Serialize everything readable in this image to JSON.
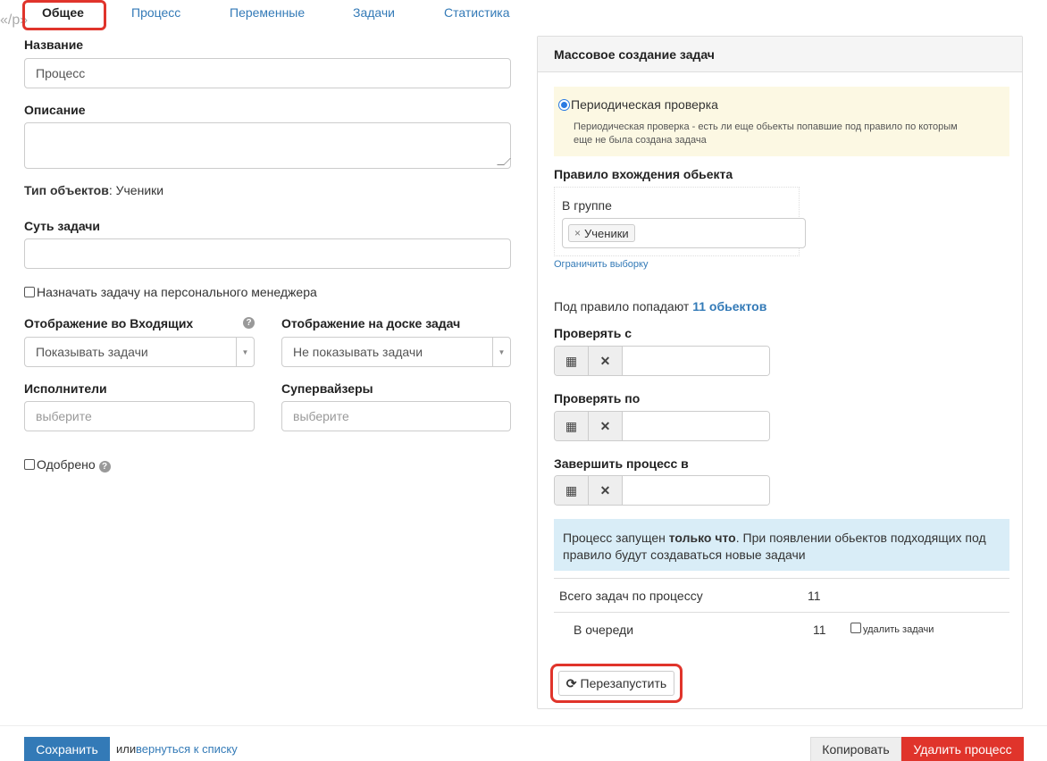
{
  "junk_text": "«/p»",
  "tabs": [
    {
      "label": "Общее"
    },
    {
      "label": "Процесс"
    },
    {
      "label": "Переменные"
    },
    {
      "label": "Задачи"
    },
    {
      "label": "Статистика"
    }
  ],
  "form": {
    "name_label": "Название",
    "name_value": "Процесс",
    "desc_label": "Описание",
    "desc_value": "",
    "object_type_label": "Тип объектов",
    "object_type_value": ": Ученики",
    "task_essence_label": "Суть задачи",
    "task_essence_value": "",
    "assign_manager_label": "Назначать задачу на персонального менеджера",
    "inbox_label": "Отображение во Входящих",
    "inbox_value": "Показывать задачи",
    "board_label": "Отображение на доске задач",
    "board_value": "Не показывать задачи",
    "executors_label": "Исполнители",
    "executors_placeholder": "выберите",
    "supervisors_label": "Супервайзеры",
    "supervisors_placeholder": "выберите",
    "approved_label": "Одобрено"
  },
  "panel": {
    "title": "Массовое создание задач",
    "radio_label": "Периодическая проверка",
    "radio_desc_1": "Периодическая проверка - есть ли еще обьекты попавшие под правило по которым",
    "radio_desc_2": "еще не была создана задача",
    "rule_label": "Правило вхождения обьекта",
    "in_group_label": "В группе",
    "tag_remove": "×",
    "tag_label": "Ученики",
    "limit_link": "Ограничить выборку",
    "matches_prefix": "Под правило попадают ",
    "matches_link": "11 обьектов",
    "check_from_label": "Проверять с",
    "check_to_label": "Проверять по",
    "finish_label": "Завершить процесс в",
    "info_prefix": "Процесс запущен ",
    "info_bold": "только что",
    "info_suffix_1": ". При появлении обьектов подходящих под",
    "info_suffix_2": "правило будут создаваться новые задачи",
    "total_label": "Всего задач по процессу",
    "total_value": "11",
    "queue_label": "В очереди",
    "queue_value": "11",
    "delete_tasks_label": "удалить задачи",
    "restart_label": "Перезапустить"
  },
  "footer": {
    "save_label": "Сохранить",
    "or_text": "или",
    "back_link": "вернуться к списку",
    "copy_label": "Копировать",
    "delete_label": "Удалить процесс"
  },
  "colors": {
    "accent": "#337ab7",
    "danger": "#e0342b",
    "warning_bg": "#fcf8e3",
    "info_bg": "#d9edf7"
  }
}
